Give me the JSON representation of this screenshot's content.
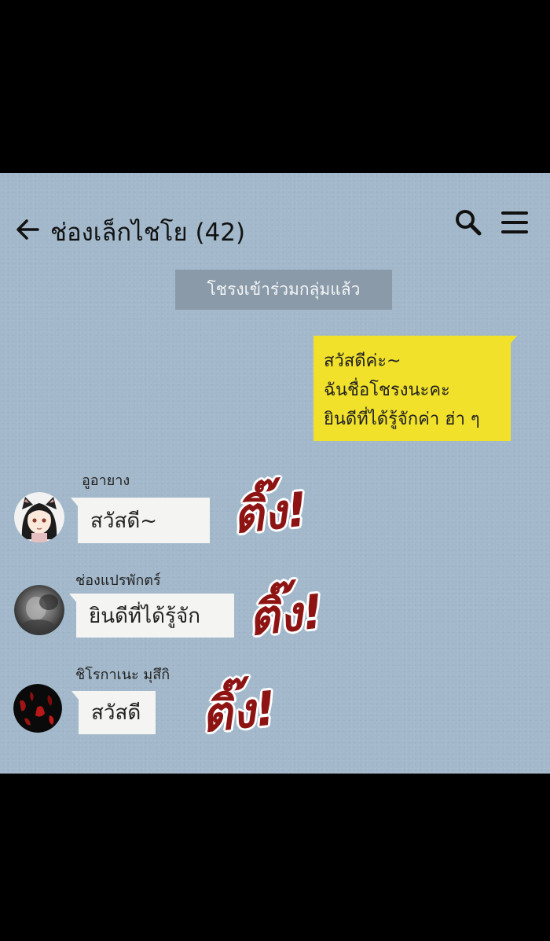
{
  "header": {
    "title": "ช่องเล็กไชโย (42)",
    "back_icon": "arrow-left-icon",
    "search_icon": "search-icon",
    "menu_icon": "hamburger-menu-icon"
  },
  "system_message": "โชรงเข้าร่วมกลุ่มแล้ว",
  "my_message": {
    "lines": [
      "สวัสดีค่ะ~",
      "ฉันชื่อโชรงนะคะ",
      "ยินดีที่ได้รู้จักค่า ฮ่า ๆ"
    ],
    "color": "#f1e12b"
  },
  "messages": [
    {
      "sender": "อูอายาง",
      "text": "สวัสดี~",
      "sfx": "ติ๊ง!"
    },
    {
      "sender": "ช่องแปรพักตร์",
      "text": "ยินดีที่ได้รู้จัก",
      "sfx": "ติ๊ง!"
    },
    {
      "sender": "ชิโรกาเนะ มุสึกิ",
      "text": "สวัสดี",
      "sfx": "ติ๊ง!"
    }
  ],
  "colors": {
    "background": "#a3b9cb",
    "system_bubble": "#8a9aa8",
    "incoming_bubble": "#f4f4f2",
    "sfx": "#8e1414"
  }
}
